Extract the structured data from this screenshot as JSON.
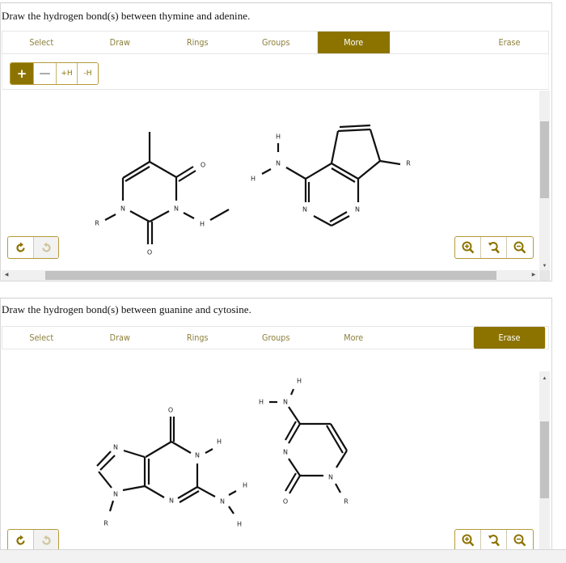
{
  "colors": {
    "accent": "#8c7300",
    "tab_text": "#8c7f3a",
    "border": "#b49a3a"
  },
  "toolbar_tabs": [
    "Select",
    "Draw",
    "Rings",
    "Groups",
    "More",
    "Erase"
  ],
  "panels": [
    {
      "question": "Draw the hydrogen bond(s) between thymine and adenine.",
      "active_tab": "More",
      "sub_buttons": [
        {
          "label": "+",
          "icon": "plus-icon",
          "active": true
        },
        {
          "label": "—",
          "icon": "minus-icon",
          "active": false
        },
        {
          "label": "+H",
          "active": false
        },
        {
          "label": "-H",
          "active": false
        }
      ],
      "undo_buttons": [
        {
          "icon": "undo-icon",
          "enabled": true
        },
        {
          "icon": "redo-icon",
          "enabled": false
        }
      ],
      "zoom_buttons": [
        {
          "icon": "zoom-in-icon"
        },
        {
          "icon": "zoom-reset-icon"
        },
        {
          "icon": "zoom-out-icon"
        }
      ],
      "molecules": {
        "thymine": {
          "atoms": [
            "N",
            "N",
            "O",
            "O",
            "R",
            "H"
          ]
        },
        "adenine": {
          "atoms": [
            "H",
            "N",
            "H",
            "N",
            "N",
            "R"
          ]
        }
      }
    },
    {
      "question": "Draw the hydrogen bond(s) between guanine and cytosine.",
      "active_tab": "Erase",
      "undo_buttons": [
        {
          "icon": "undo-icon",
          "enabled": true
        },
        {
          "icon": "redo-icon",
          "enabled": false
        }
      ],
      "zoom_buttons": [
        {
          "icon": "zoom-in-icon"
        },
        {
          "icon": "zoom-reset-icon"
        },
        {
          "icon": "zoom-out-icon"
        }
      ],
      "molecules": {
        "guanine": {
          "atoms": [
            "O",
            "N",
            "H",
            "N",
            "N",
            "N",
            "N",
            "H",
            "H",
            "R"
          ]
        },
        "cytosine": {
          "atoms": [
            "H",
            "H",
            "N",
            "N",
            "N",
            "O",
            "R"
          ]
        }
      }
    }
  ],
  "labels": {
    "N": "N",
    "O": "O",
    "H": "H",
    "R": "R"
  },
  "scroll_arrows": {
    "up": "▲",
    "down": "▼",
    "left": "◀",
    "right": "▶"
  }
}
